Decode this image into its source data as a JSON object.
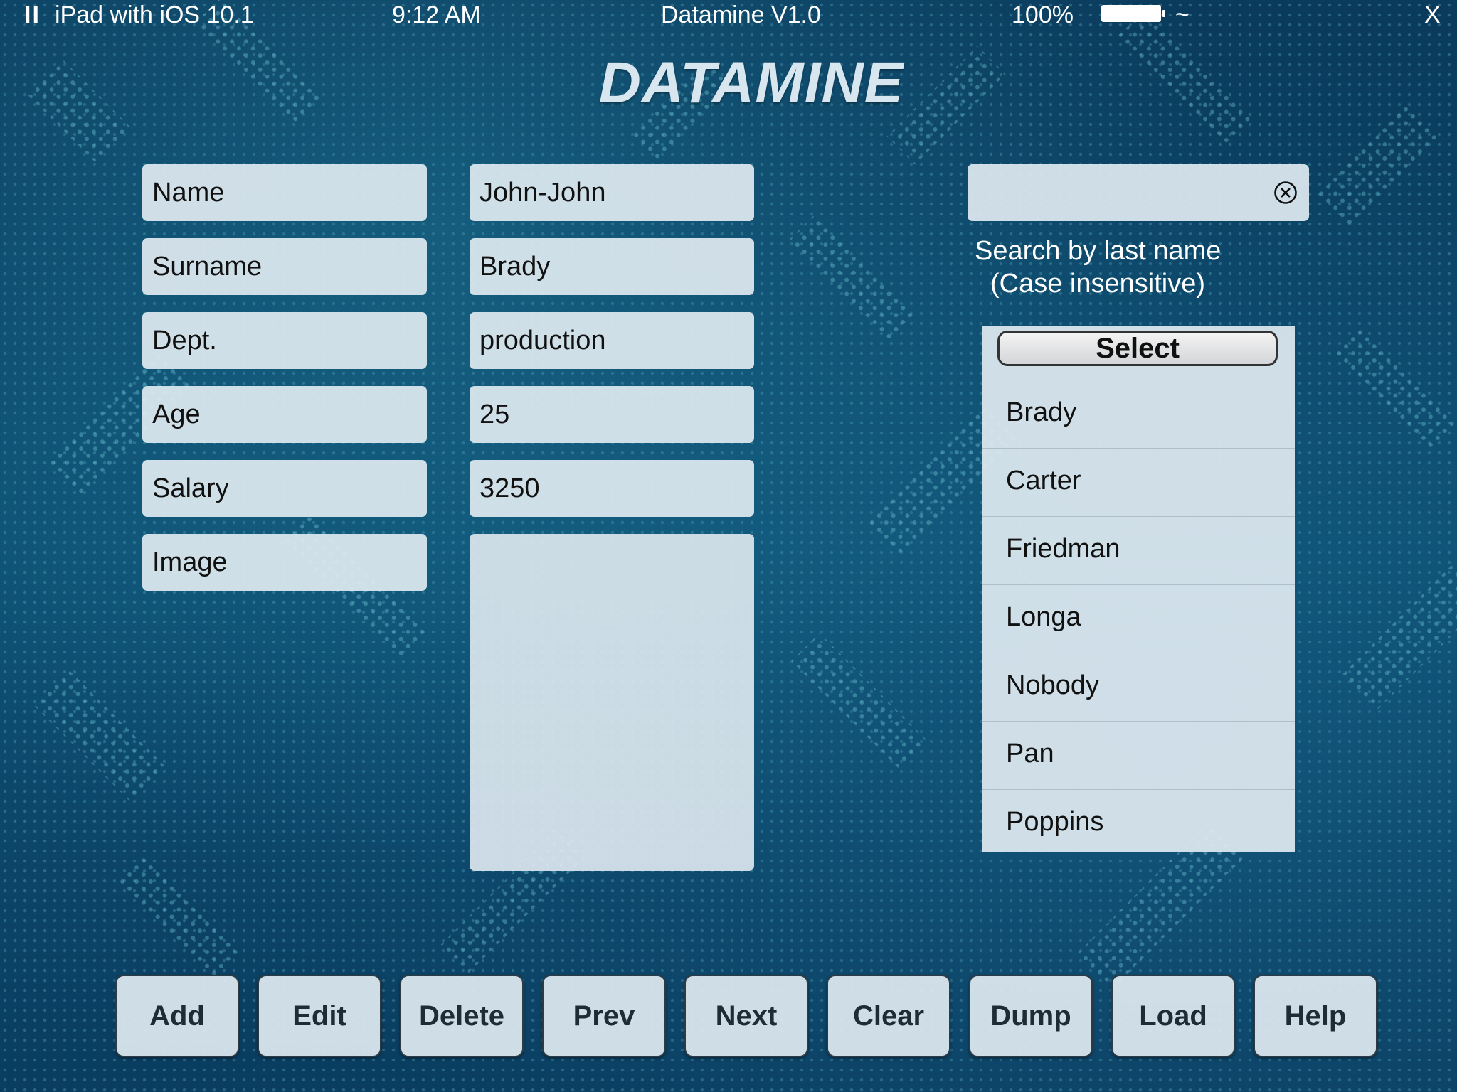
{
  "status_bar": {
    "pause": "II",
    "device": "iPad with iOS 10.1",
    "time": "9:12 AM",
    "title": "Datamine V1.0",
    "battery": "100%",
    "wifi": "~",
    "close": "X"
  },
  "app_title": "DATAMINE",
  "form": {
    "labels": {
      "name": "Name",
      "surname": "Surname",
      "dept": "Dept.",
      "age": "Age",
      "salary": "Salary",
      "image": "Image"
    },
    "values": {
      "name": "John-John",
      "surname": "Brady",
      "dept": "production",
      "age": "25",
      "salary": "3250"
    }
  },
  "search": {
    "value": "",
    "hint_line1": "Search by last name",
    "hint_line2": "(Case insensitive)"
  },
  "picker": {
    "select_label": "Select",
    "items": [
      "Brady",
      "Carter",
      "Friedman",
      "Longa",
      "Nobody",
      "Pan",
      "Poppins"
    ]
  },
  "buttons": {
    "add": "Add",
    "edit": "Edit",
    "delete": "Delete",
    "prev": "Prev",
    "next": "Next",
    "clear": "Clear",
    "dump": "Dump",
    "load": "Load",
    "help": "Help"
  }
}
